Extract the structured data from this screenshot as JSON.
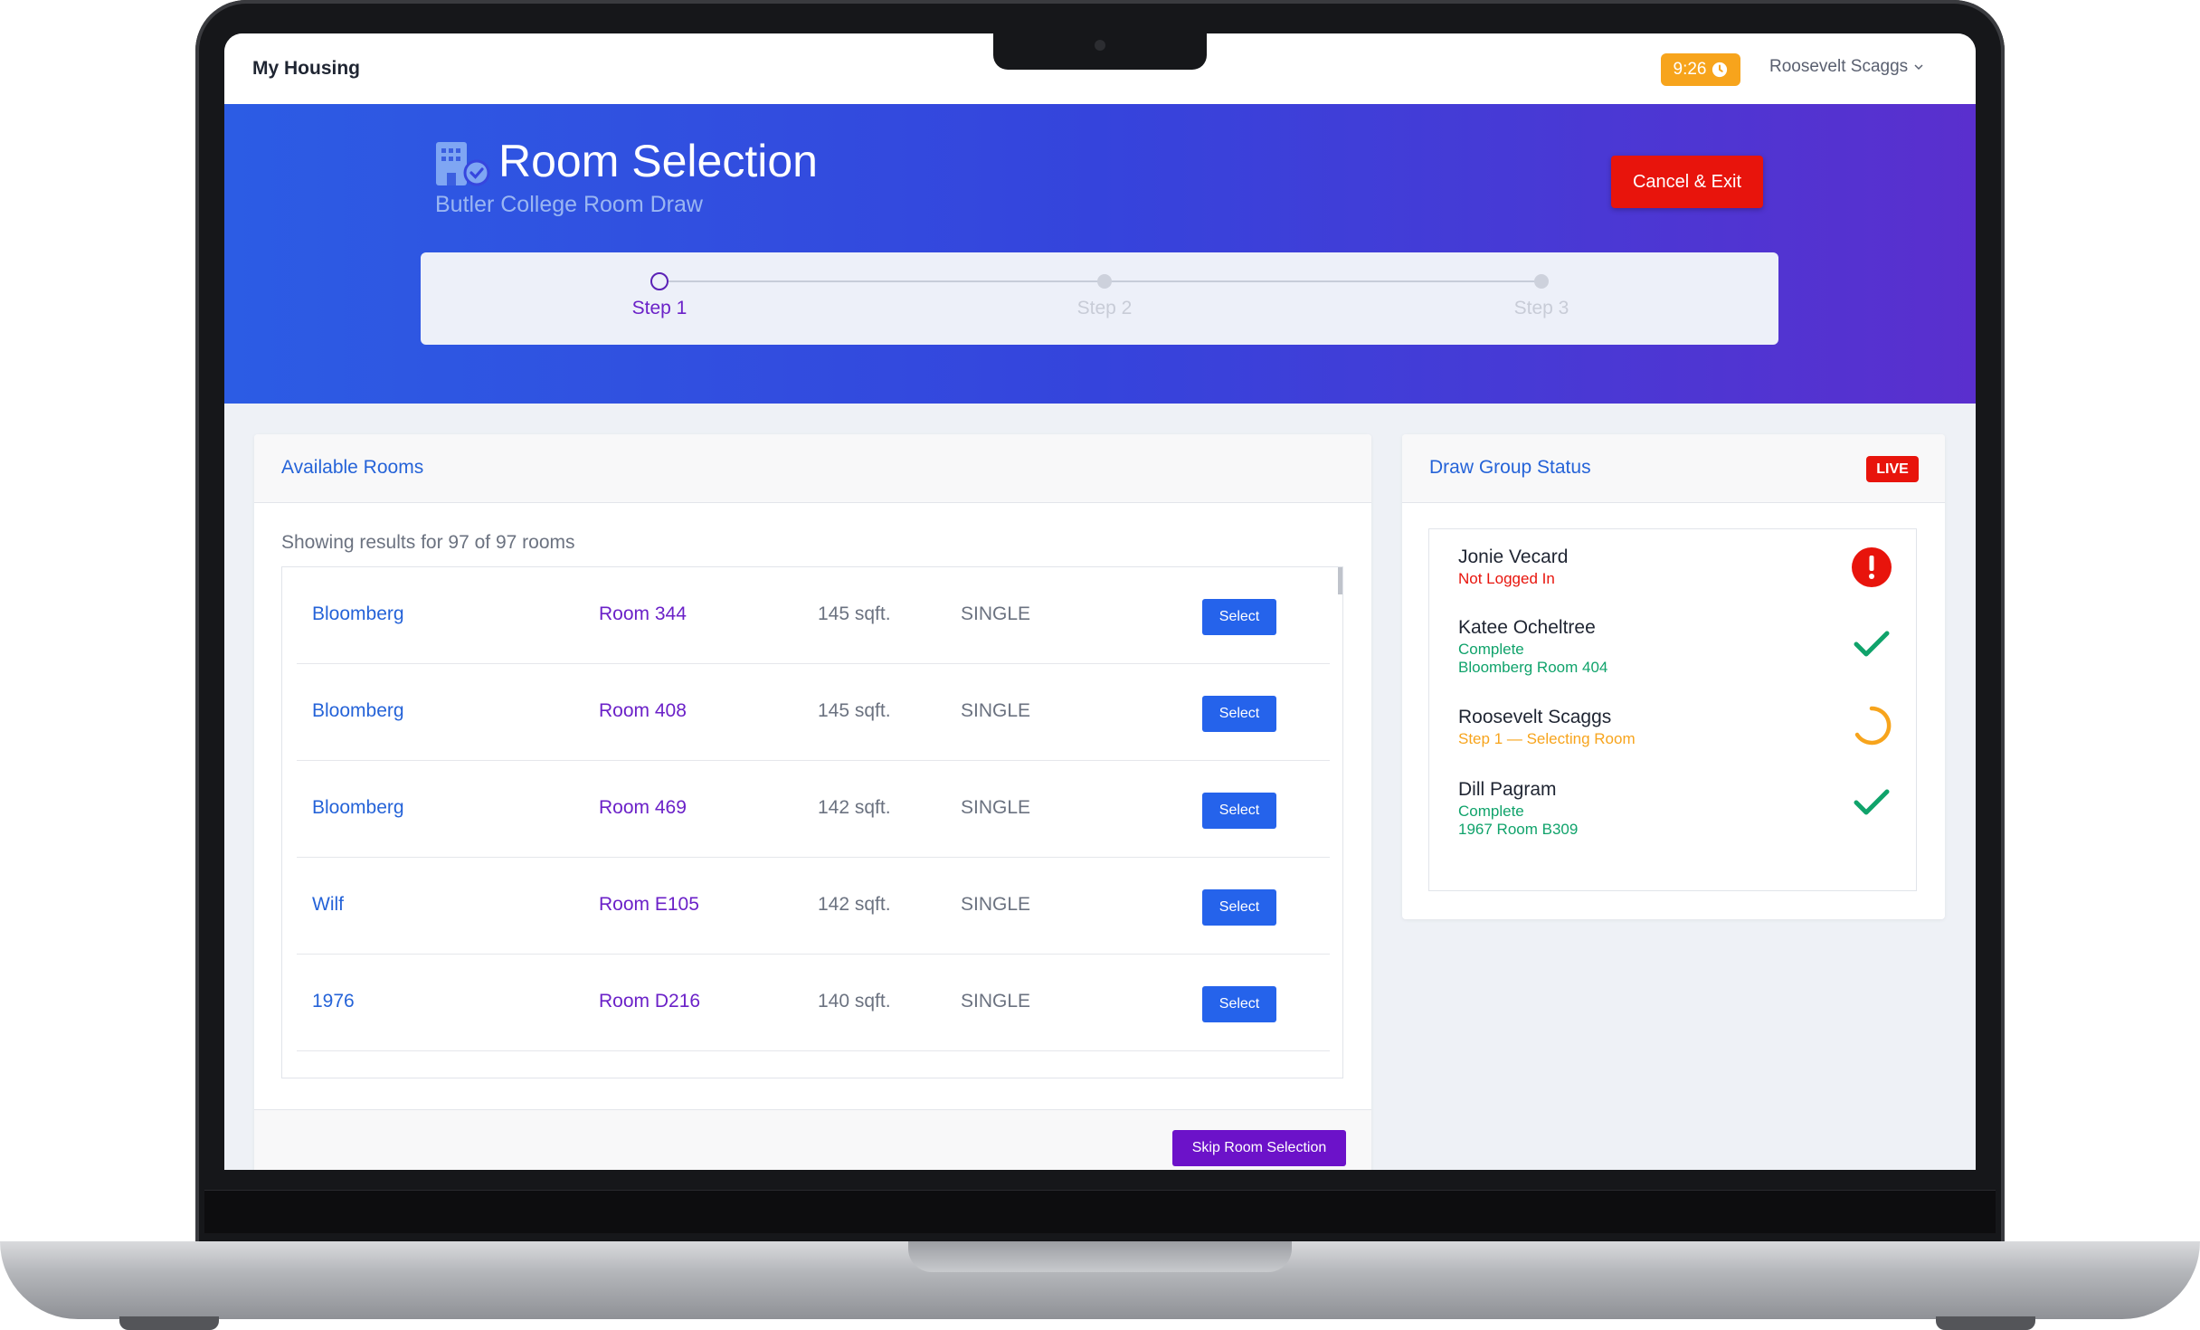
{
  "topbar": {
    "app_name": "My Housing",
    "timer": "9:26",
    "user_name": "Roosevelt Scaggs"
  },
  "hero": {
    "title": "Room Selection",
    "subtitle": "Butler College Room Draw",
    "cancel_label": "Cancel & Exit",
    "steps": [
      {
        "label": "Step 1",
        "state": "active"
      },
      {
        "label": "Step 2",
        "state": "inactive"
      },
      {
        "label": "Step 3",
        "state": "inactive"
      }
    ]
  },
  "rooms": {
    "title": "Available Rooms",
    "results_text": "Showing results for 97 of 97 rooms",
    "select_label": "Select",
    "skip_label": "Skip Room Selection",
    "rows": [
      {
        "building": "Bloomberg",
        "room": "Room 344",
        "size": "145 sqft.",
        "type": "SINGLE"
      },
      {
        "building": "Bloomberg",
        "room": "Room 408",
        "size": "145 sqft.",
        "type": "SINGLE"
      },
      {
        "building": "Bloomberg",
        "room": "Room 469",
        "size": "142 sqft.",
        "type": "SINGLE"
      },
      {
        "building": "Wilf",
        "room": "Room E105",
        "size": "142 sqft.",
        "type": "SINGLE"
      },
      {
        "building": "1976",
        "room": "Room D216",
        "size": "140 sqft.",
        "type": "SINGLE"
      }
    ]
  },
  "status": {
    "title": "Draw Group Status",
    "live_label": "LIVE",
    "members": [
      {
        "name": "Jonie Vecard",
        "status": "Not Logged In",
        "detail": "",
        "state": "error",
        "icon": "alert-icon"
      },
      {
        "name": "Katee Ocheltree",
        "status": "Complete",
        "detail": "Bloomberg Room 404",
        "state": "complete",
        "icon": "check-icon"
      },
      {
        "name": "Roosevelt Scaggs",
        "status": "Step 1 — Selecting Room",
        "detail": "",
        "state": "progress",
        "icon": "spinner-icon"
      },
      {
        "name": "Dill Pagram",
        "status": "Complete",
        "detail": "1967 Room B309",
        "state": "complete",
        "icon": "check-icon"
      }
    ]
  },
  "colors": {
    "primary_blue": "#2563eb",
    "purple": "#6c12c9",
    "danger": "#e8140c",
    "warning": "#f7a41c",
    "success": "#10a36b"
  }
}
